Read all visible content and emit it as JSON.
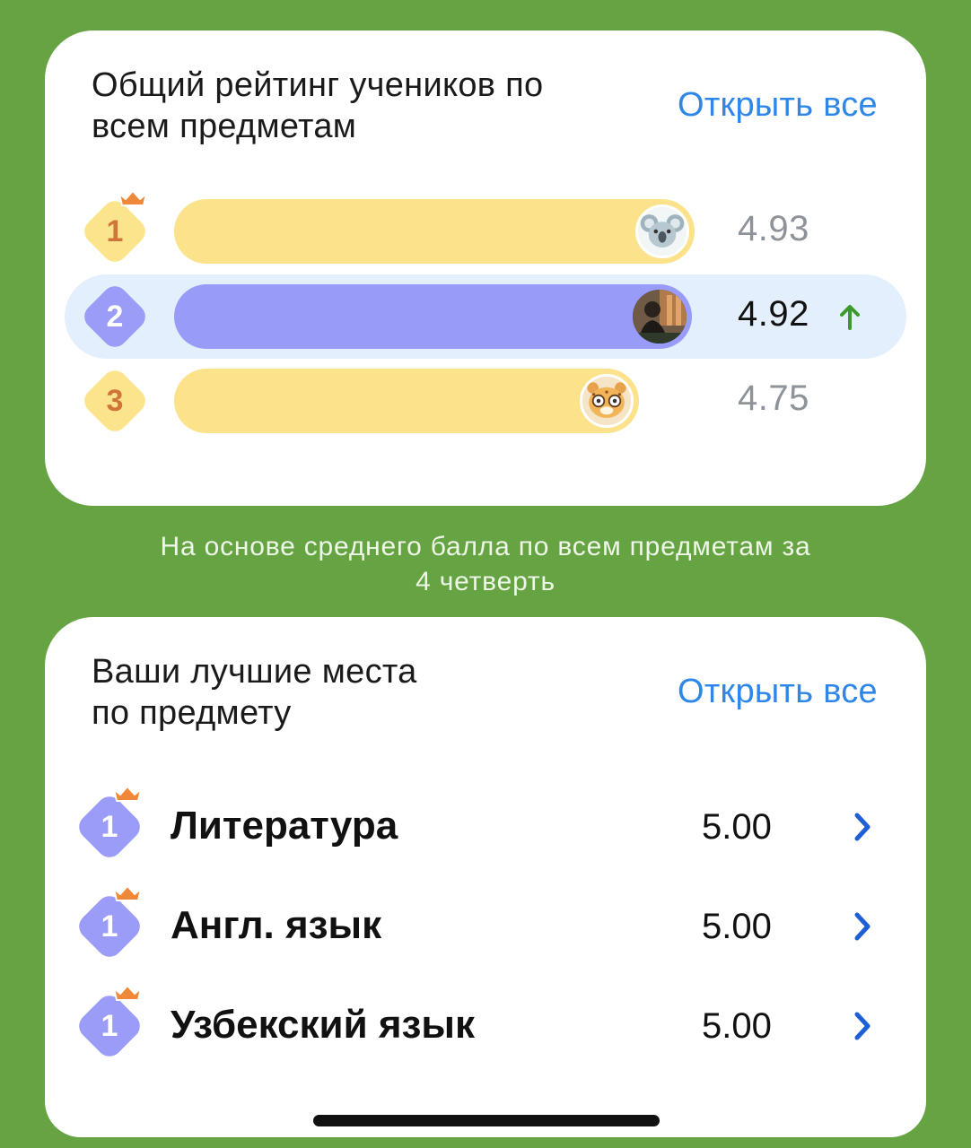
{
  "overall": {
    "title": "Общий рейтинг учеников по\nвсем предметам",
    "open_all": "Открыть все",
    "rows": [
      {
        "rank": "1",
        "score": "4.93",
        "fill": 0.9,
        "avatar": "koala-avatar-icon",
        "is_me": false
      },
      {
        "rank": "2",
        "score": "4.92",
        "fill": 0.89,
        "avatar": "user-photo",
        "is_me": true
      },
      {
        "rank": "3",
        "score": "4.75",
        "fill": 0.8,
        "avatar": "cheetah-avatar-icon",
        "is_me": false
      }
    ]
  },
  "caption": "На основе среднего балла по всем предметам за\n4 четверть",
  "best_places": {
    "title": "Ваши лучшие места\nпо предмету",
    "open_all": "Открыть все",
    "rows": [
      {
        "rank": "1",
        "subject": "Литература",
        "score": "5.00"
      },
      {
        "rank": "1",
        "subject": "Англ. язык",
        "score": "5.00"
      },
      {
        "rank": "1",
        "subject": "Узбекский язык",
        "score": "5.00"
      }
    ]
  },
  "colors": {
    "background": "#66a343",
    "gold_bar": "#fbe28b",
    "gold_badge": "#fce48c",
    "gold_number": "#d0743a",
    "me_bar": "#999bf9",
    "purple_badge": "#9a9cf8",
    "accent_link": "#2d86e8",
    "up_arrow": "#3b9a2b",
    "crown": "#f0883a",
    "chevron": "#1f5fd6"
  }
}
